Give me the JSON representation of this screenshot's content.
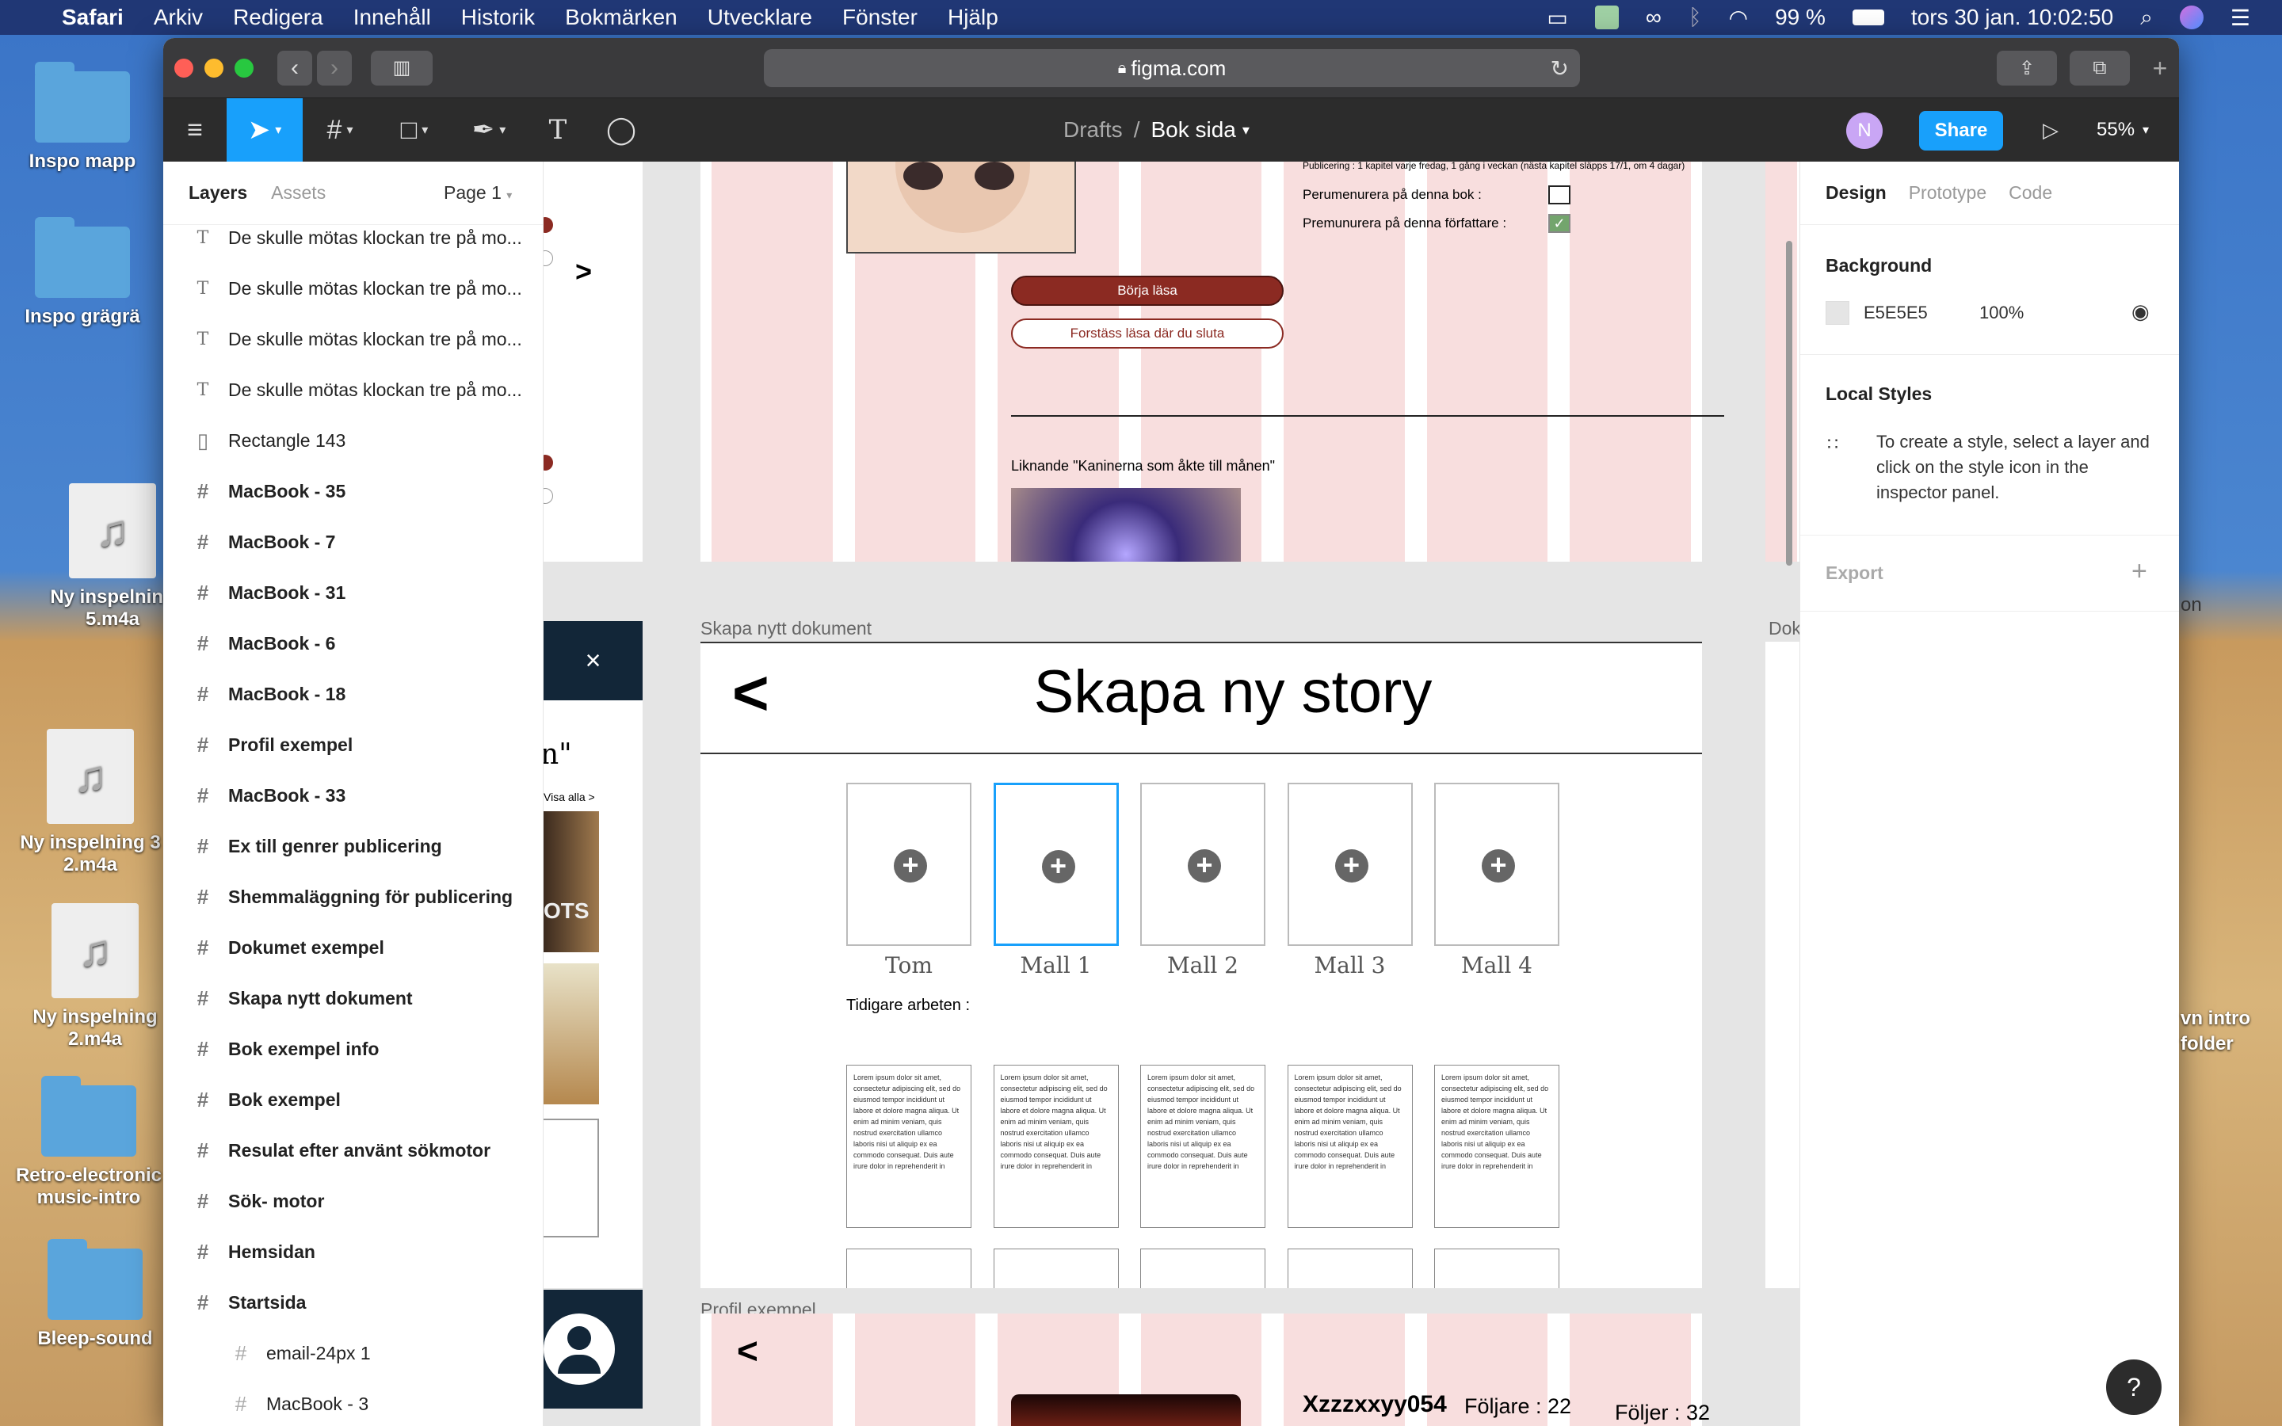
{
  "menubar": {
    "app": "Safari",
    "items": [
      "Arkiv",
      "Redigera",
      "Innehåll",
      "Historik",
      "Bokmärken",
      "Utvecklare",
      "Fönster",
      "Hjälp"
    ],
    "battery": "99 %",
    "clock": "tors 30 jan.  10:02:50"
  },
  "desktop": {
    "icons": [
      "Inspo mapp",
      "Inspo grägrä",
      "Ny inspelning 5.m4a",
      "Ny inspelning 3 2.m4a",
      "Ny inspelning 2.m4a",
      "Retro-electronic music-intro",
      "Bleep-sound"
    ]
  },
  "safari": {
    "url": "figma.com"
  },
  "figma": {
    "breadcrumb_root": "Drafts",
    "breadcrumb_sep": "/",
    "file_name": "Bok sida",
    "avatar": "N",
    "share": "Share",
    "zoom": "55%"
  },
  "left_panel": {
    "tab_layers": "Layers",
    "tab_assets": "Assets",
    "page": "Page 1",
    "layers": [
      {
        "type": "text",
        "name": "De skulle mötas klockan tre på mo..."
      },
      {
        "type": "text",
        "name": "De skulle mötas klockan tre på mo..."
      },
      {
        "type": "text",
        "name": "De skulle mötas klockan tre på mo..."
      },
      {
        "type": "text",
        "name": "De skulle mötas klockan tre på mo..."
      },
      {
        "type": "rect",
        "name": "Rectangle 143"
      },
      {
        "type": "frame",
        "name": "MacBook - 35"
      },
      {
        "type": "frame",
        "name": "MacBook - 7"
      },
      {
        "type": "frame",
        "name": "MacBook - 31"
      },
      {
        "type": "frame",
        "name": "MacBook - 6"
      },
      {
        "type": "frame",
        "name": "MacBook - 18"
      },
      {
        "type": "frame",
        "name": "Profil exempel"
      },
      {
        "type": "frame",
        "name": "MacBook - 33"
      },
      {
        "type": "frame",
        "name": "Ex till genrer publicering"
      },
      {
        "type": "frame",
        "name": "Shemmaläggning för publicering"
      },
      {
        "type": "frame",
        "name": "Dokumet exempel"
      },
      {
        "type": "frame",
        "name": "Skapa nytt dokument"
      },
      {
        "type": "frame",
        "name": "Bok exempel info"
      },
      {
        "type": "frame",
        "name": "Bok exempel"
      },
      {
        "type": "frame",
        "name": "Resulat efter använt sökmotor"
      },
      {
        "type": "frame",
        "name": "Sök- motor"
      },
      {
        "type": "frame",
        "name": "Hemsidan"
      },
      {
        "type": "frame",
        "name": "Startsida"
      },
      {
        "type": "child",
        "name": "email-24px 1"
      },
      {
        "type": "child",
        "name": "MacBook - 3"
      }
    ]
  },
  "canvas": {
    "top_frame": {
      "pub_text": "Publicering : 1 kapitel varje fredag, 1 gång i veckan (nästa kapitel släpps 17/1, om 4 dagar)",
      "opt1": "Perumenurera på denna bok :",
      "opt2": "Premunurera på denna författare :",
      "btn_read": "Börja läsa",
      "btn_continue": "Forstäss läsa där du sluta",
      "similar": "Liknande \"Kaninerna som åkte till månen\""
    },
    "left_partial": {
      "close": "×",
      "quote": "n\"",
      "see_all": "Visa alla >",
      "book_text": "OTS"
    },
    "frame_label": "Skapa nytt dokument",
    "right_label": "Dok",
    "frame": {
      "back": "<",
      "title": "Skapa ny story",
      "templates": [
        "Tom",
        "Mall 1",
        "Mall 2",
        "Mall 3",
        "Mall 4"
      ],
      "previous": "Tidigare arbeten :",
      "lorem": "Lorem ipsum dolor sit amet, consectetur adipiscing elit, sed do eiusmod tempor incididunt ut labore et dolore magna aliqua. Ut enim ad minim veniam, quis nostrud exercitation ullamco laboris nisi ut aliquip ex ea commodo consequat. Duis aute irure dolor in reprehenderit in"
    },
    "profile_label": "Profil exempel",
    "profile": {
      "back": "<",
      "username": "Xzzzxxyy054",
      "followers": "Följare : 22",
      "following": "Följer : 32"
    }
  },
  "right_panel": {
    "tabs": [
      "Design",
      "Prototype",
      "Code"
    ],
    "background_title": "Background",
    "bg_hex": "E5E5E5",
    "bg_opacity": "100%",
    "local_styles_title": "Local Styles",
    "local_styles_hint": "To create a style, select a layer and click on the style icon in the inspector panel.",
    "export_title": "Export",
    "help": "?"
  },
  "colors": {
    "accent": "#18a0fb",
    "pink": "#f8dede",
    "button_red": "#8b2a22",
    "canvas": "#e5e5e5"
  }
}
